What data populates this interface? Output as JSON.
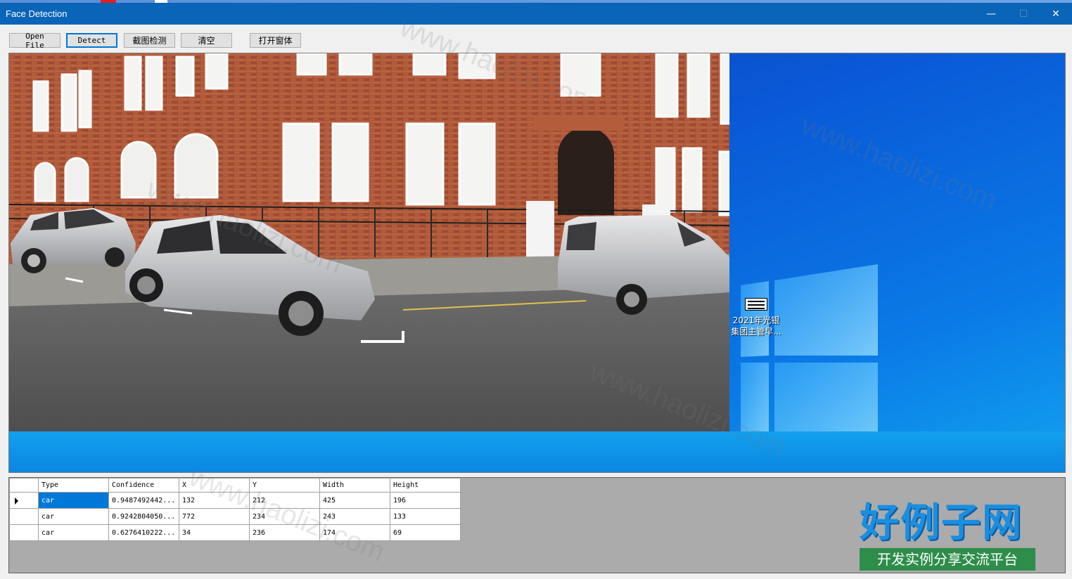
{
  "window": {
    "title": "Face Detection",
    "minimize_glyph": "—",
    "maximize_glyph": "☐",
    "close_glyph": "✕"
  },
  "toolbar": {
    "open_file": "Open File",
    "detect": "Detect",
    "screenshot_detect": "截图检测",
    "clear": "清空",
    "open_window": "打开窗体"
  },
  "desktop": {
    "icon_name": "doc-icon",
    "icon_label_line1": "2021年光银",
    "icon_label_line2": "集团主管早..."
  },
  "grid": {
    "columns": [
      "Type",
      "Confidence",
      "X",
      "Y",
      "Width",
      "Height"
    ],
    "rows": [
      {
        "type": "car",
        "confidence": "0.9487492442...",
        "x": "132",
        "y": "212",
        "width": "425",
        "height": "196"
      },
      {
        "type": "car",
        "confidence": "0.9242804050...",
        "x": "772",
        "y": "234",
        "width": "243",
        "height": "133"
      },
      {
        "type": "car",
        "confidence": "0.6276410222...",
        "x": "34",
        "y": "236",
        "width": "174",
        "height": "69"
      }
    ]
  },
  "watermark": {
    "brand": "好例子网",
    "slogan": "开发实例分享交流平台",
    "url": "www.haolizi.com"
  },
  "colors": {
    "titlebar": "#0a64b8",
    "selection": "#0078d7",
    "brand_blue": "#1b8ee0",
    "brand_green": "#2e8d4a"
  }
}
